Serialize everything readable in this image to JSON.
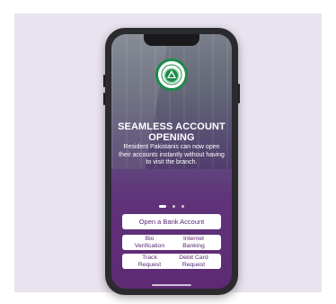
{
  "app": {
    "headline_line1": "SEAMLESS ACCOUNT",
    "headline_line2": "OPENING",
    "description": "Resident Pakistanis can now open their accounts instantly without having to visit the branch.",
    "logo_top_text": "NATIONAL",
    "logo_bottom_text": "BANK"
  },
  "carousel": {
    "total_slides": 3,
    "active_slide": 1
  },
  "actions": {
    "primary_label": "Open a Bank Account",
    "buttons": [
      {
        "label": "Bio\nVerification"
      },
      {
        "label": "Internet\nBanking"
      },
      {
        "label": "Track\nRequest"
      },
      {
        "label": "Debit Card\nRequest"
      }
    ]
  },
  "colors": {
    "background_panel": "#e9e3ef",
    "brand_green": "#1d8a48",
    "brand_purple": "#5a2676"
  }
}
